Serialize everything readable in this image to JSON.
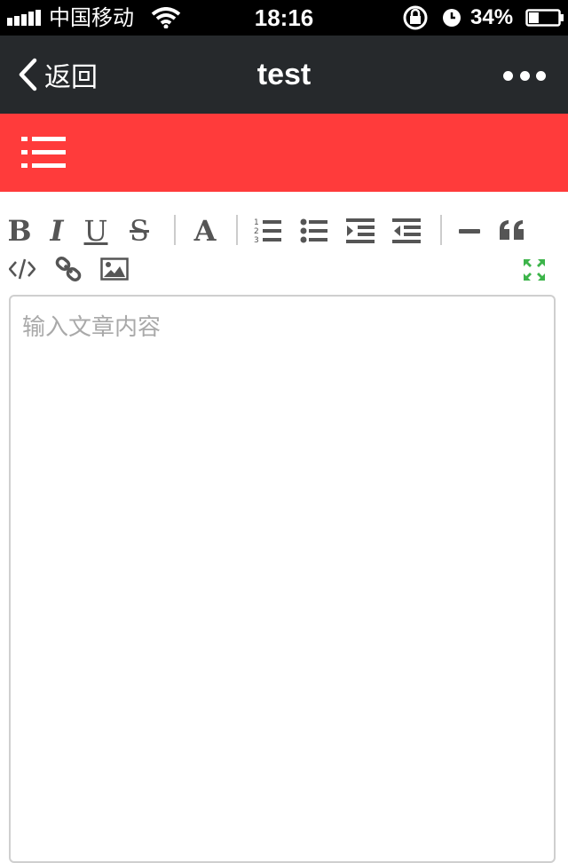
{
  "status_bar": {
    "carrier": "中国移动",
    "time": "18:16",
    "battery_percent": "34%",
    "battery_level": 0.34
  },
  "nav": {
    "back_label": "返回",
    "title": "test",
    "more_icon": "more-dots-icon"
  },
  "header": {
    "menu_icon": "list-menu-icon",
    "color": "#ff3b3b"
  },
  "toolbar": {
    "bold": "B",
    "italic": "I",
    "underline": "U",
    "strikethrough": "S",
    "font_color": "A",
    "icons": [
      "ordered-list-icon",
      "unordered-list-icon",
      "indent-icon",
      "outdent-icon",
      "horizontal-rule-icon",
      "quote-icon",
      "code-icon",
      "link-icon",
      "image-icon",
      "fullscreen-icon"
    ],
    "fullscreen_color": "#3cb44a"
  },
  "editor": {
    "placeholder": "输入文章内容"
  }
}
